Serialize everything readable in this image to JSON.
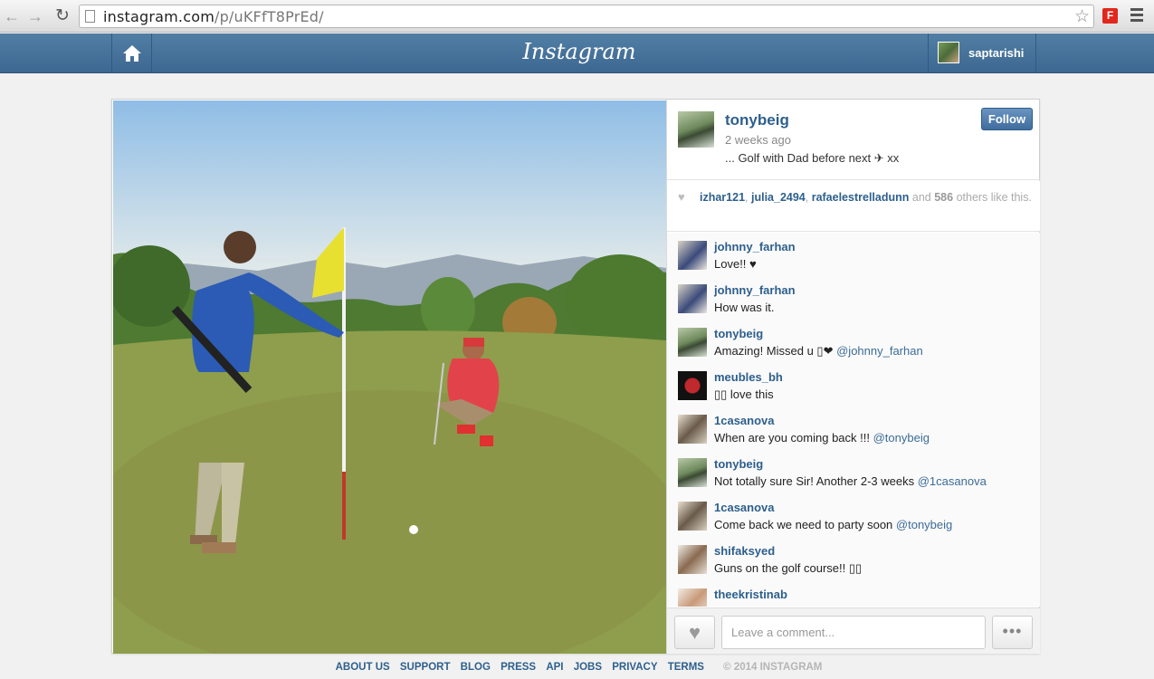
{
  "browser": {
    "url_host": "instagram.com",
    "url_path": "/p/uKFfT8PrEd/"
  },
  "header": {
    "logo": "Instagram",
    "username": "saptarishi"
  },
  "post": {
    "owner": "tonybeig",
    "time": "2 weeks ago",
    "caption": "... Golf with Dad before next ✈ xx",
    "follow_label": "Follow"
  },
  "likes": {
    "users": [
      "izhar121",
      "julia_2494",
      "rafaelestrelladunn"
    ],
    "and_text": "and",
    "count": "586",
    "others_text": "others like this."
  },
  "comments": [
    {
      "user": "johnny_farhan",
      "text": "Love!! ♥",
      "mention": ""
    },
    {
      "user": "johnny_farhan",
      "text": "How was it.",
      "mention": ""
    },
    {
      "user": "tonybeig",
      "text": "Amazing! Missed u ▯❤",
      "mention": "@johnny_farhan"
    },
    {
      "user": "meubles_bh",
      "text": "▯▯ love this",
      "mention": ""
    },
    {
      "user": "1casanova",
      "text": "When are you coming back !!!",
      "mention": "@tonybeig"
    },
    {
      "user": "tonybeig",
      "text": "Not totally sure Sir! Another 2-3 weeks",
      "mention": "@1casanova"
    },
    {
      "user": "1casanova",
      "text": "Come back we need to party soon",
      "mention": "@tonybeig"
    },
    {
      "user": "shifaksyed",
      "text": "Guns on the golf course!! ▯▯",
      "mention": ""
    },
    {
      "user": "theekristinab",
      "text": "",
      "mention": ""
    }
  ],
  "comment_box": {
    "placeholder": "Leave a comment...",
    "more_label": "•••"
  },
  "footer": {
    "links": [
      "ABOUT US",
      "SUPPORT",
      "BLOG",
      "PRESS",
      "API",
      "JOBS",
      "PRIVACY",
      "TERMS"
    ],
    "copyright": "© 2014 INSTAGRAM"
  },
  "colors": {
    "header_blue": "#3d6791",
    "link_blue": "#2d5f8d"
  }
}
